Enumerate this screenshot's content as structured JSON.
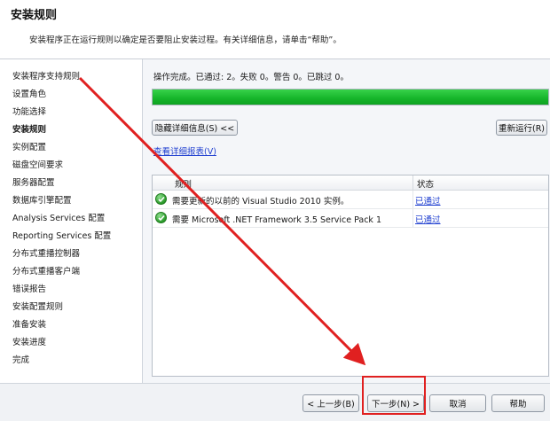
{
  "header": {
    "title": "安装规则",
    "description": "安装程序正在运行规则以确定是否要阻止安装过程。有关详细信息，请单击“帮助”。"
  },
  "nav": {
    "items": [
      "安装程序支持规则",
      "设置角色",
      "功能选择",
      "安装规则",
      "实例配置",
      "磁盘空间要求",
      "服务器配置",
      "数据库引擎配置",
      "Analysis Services 配置",
      "Reporting Services 配置",
      "分布式重播控制器",
      "分布式重播客户端",
      "错误报告",
      "安装配置规则",
      "准备安装",
      "安装进度",
      "完成"
    ],
    "active_index": 3
  },
  "main": {
    "status_text": "操作完成。已通过: 2。失败 0。警告 0。已跳过 0。",
    "progress": 1.0,
    "progress_color": "#1dbb30",
    "hide_details_label": "隐藏详细信息(S) <<",
    "rerun_label": "重新运行(R)",
    "view_report_label": "查看详细报表(V)",
    "table": {
      "col_rule": "规则",
      "col_status": "状态",
      "rows": [
        {
          "rule": "需要更新的以前的 Visual Studio 2010 实例。",
          "status": "已通过"
        },
        {
          "rule": "需要 Microsoft .NET Framework 3.5 Service Pack 1",
          "status": "已通过"
        }
      ]
    }
  },
  "footer": {
    "back_label": "< 上一步(B)",
    "next_label": "下一步(N) >",
    "cancel_label": "取消",
    "help_label": "帮助"
  },
  "annotation": {
    "color": "#e02020",
    "icon": "red-arrow-icon"
  }
}
